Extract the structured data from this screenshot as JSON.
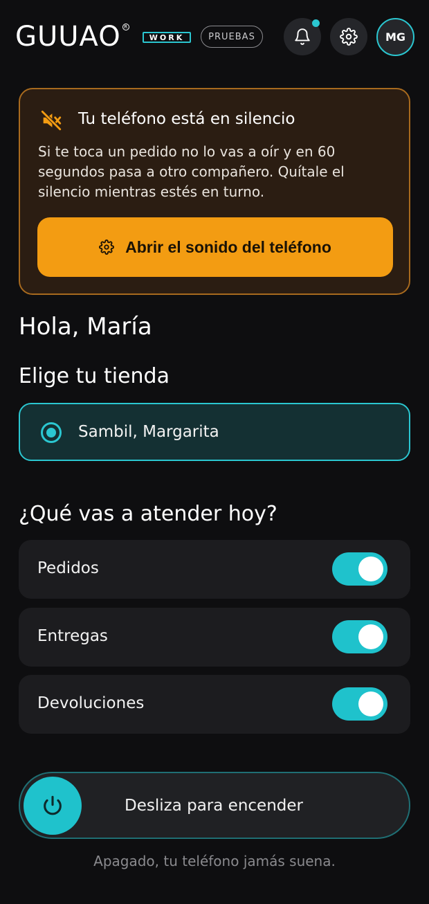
{
  "header": {
    "logo_text": "GUUAO",
    "logo_reg": "R",
    "work_badge": "WORK",
    "env_badge": "PRUEBAS",
    "avatar_initials": "MG",
    "notification_dot_color": "#2bc7d1"
  },
  "silence_warning": {
    "title": "Tu teléfono está en silencio",
    "body": "Si te toca un pedido no lo vas a oír y en 60 segundos pasa a otro compañero. Quítale el silencio mientras estés en turno.",
    "button_label": "Abrir el sonido del teléfono",
    "icon": "muted-speaker-icon",
    "accent_color": "#f39c12"
  },
  "greeting": "Hola, María",
  "store": {
    "heading": "Elige tu tienda",
    "selected_label": "Sambil, Margarita",
    "selected": true
  },
  "tasks": {
    "heading": "¿Qué vas a atender hoy?",
    "items": [
      {
        "label": "Pedidos",
        "enabled": true
      },
      {
        "label": "Entregas",
        "enabled": true
      },
      {
        "label": "Devoluciones",
        "enabled": true
      }
    ]
  },
  "power_slider": {
    "label": "Desliza para encender",
    "icon": "power-icon",
    "status_text": "Apagado, tu teléfono jamás suena."
  },
  "colors": {
    "accent": "#2bc7d1",
    "warning": "#f39c12",
    "background": "#0e0e10"
  }
}
